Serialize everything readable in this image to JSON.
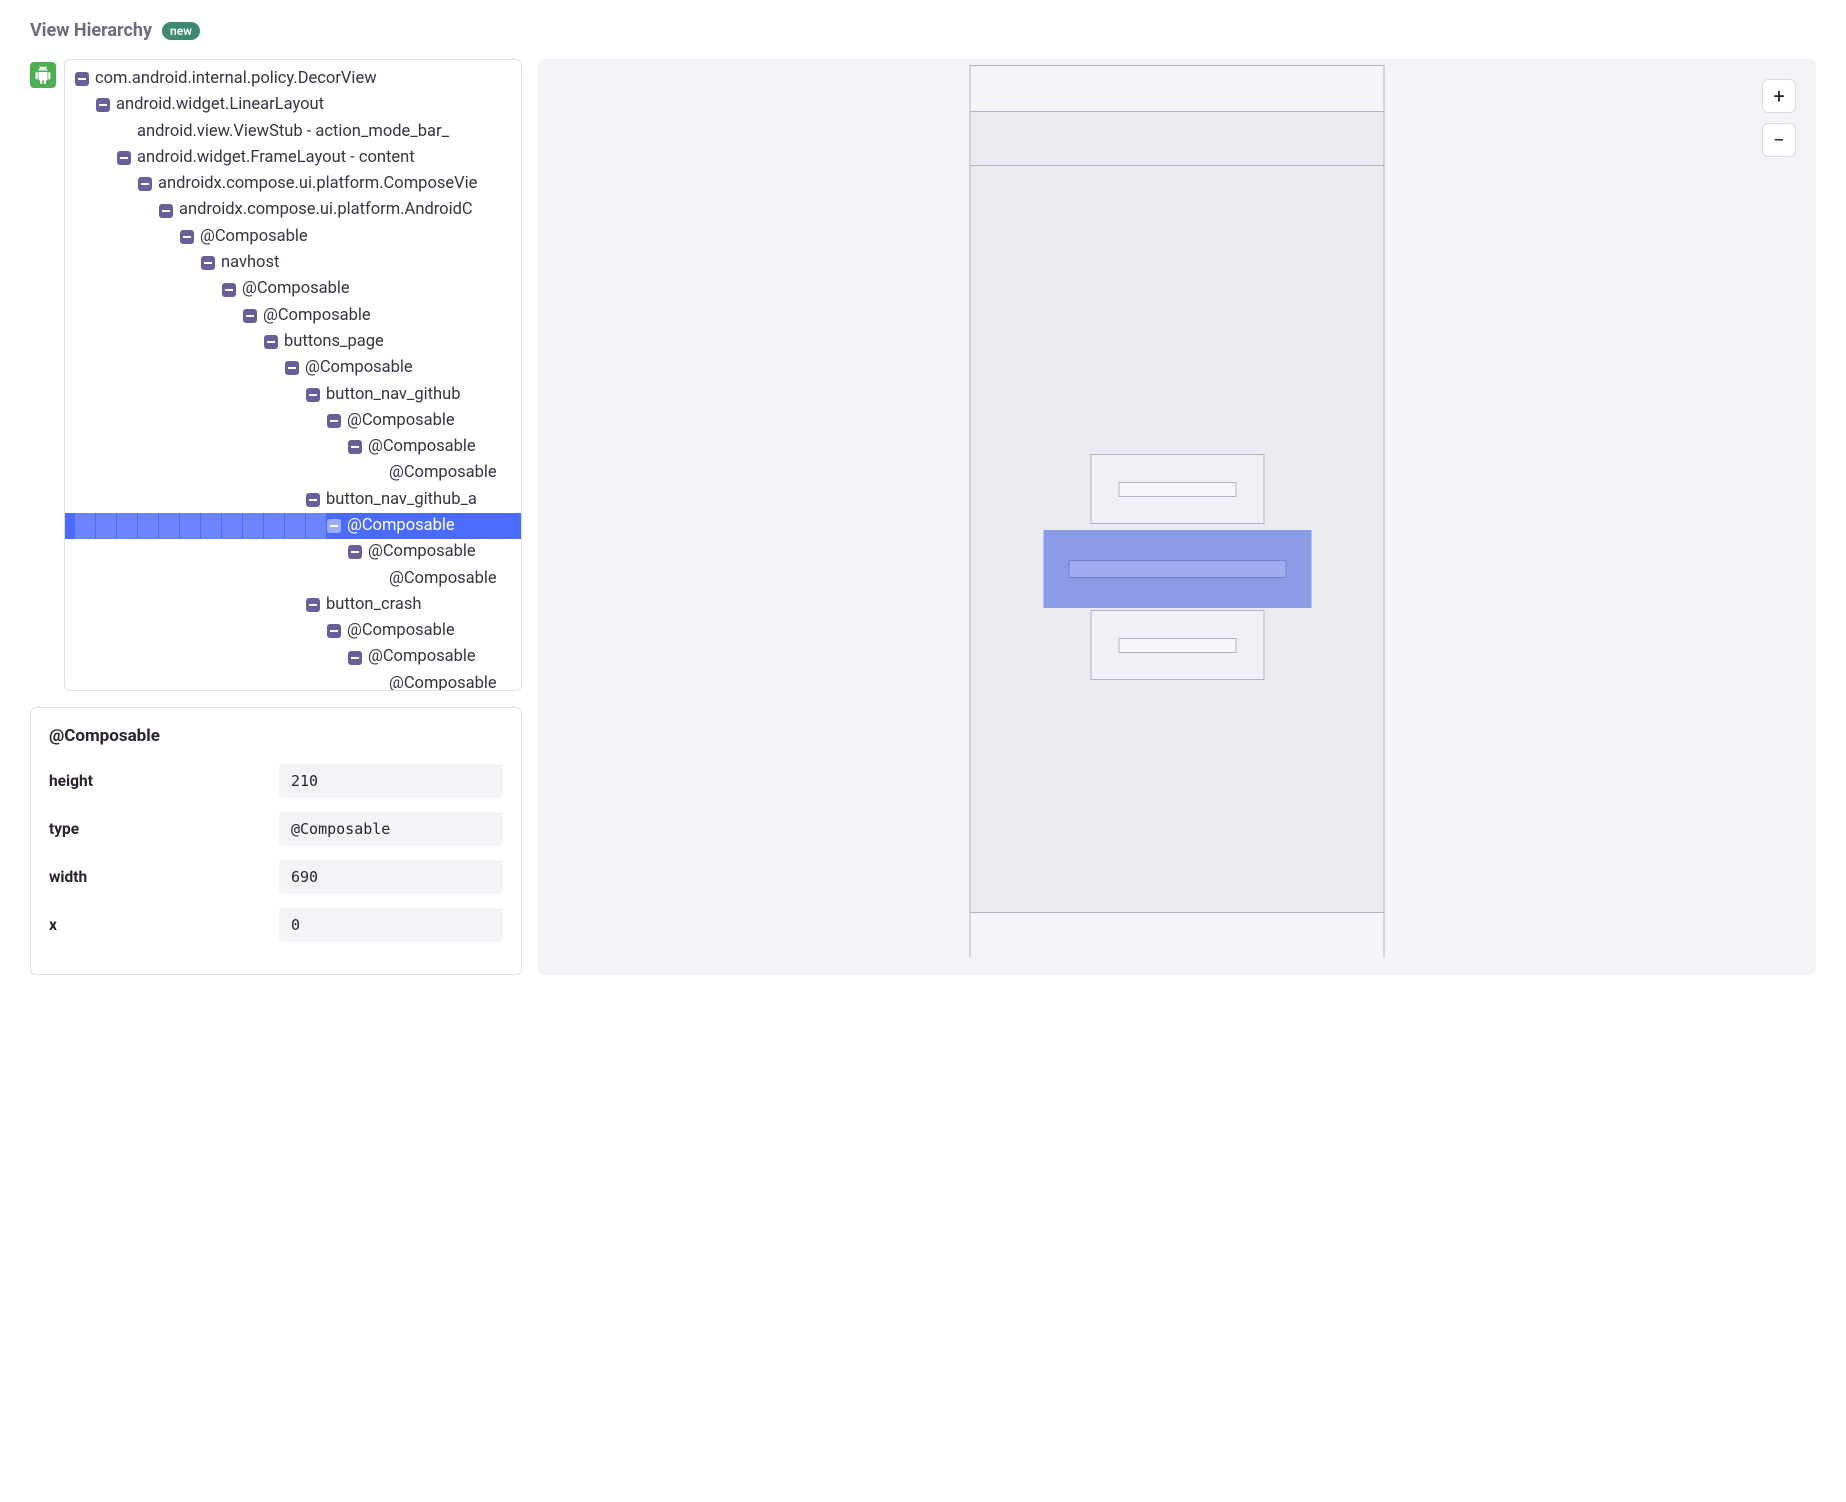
{
  "header": {
    "title": "View Hierarchy",
    "badge": "new"
  },
  "tree": [
    {
      "depth": 0,
      "expand": true,
      "label": "com.android.internal.policy.DecorView",
      "sel": false
    },
    {
      "depth": 1,
      "expand": true,
      "label": "android.widget.LinearLayout",
      "sel": false
    },
    {
      "depth": 2,
      "expand": false,
      "label": "android.view.ViewStub - action_mode_bar_",
      "sel": false
    },
    {
      "depth": 2,
      "expand": true,
      "label": "android.widget.FrameLayout - content",
      "sel": false
    },
    {
      "depth": 3,
      "expand": true,
      "label": "androidx.compose.ui.platform.ComposeVie",
      "sel": false
    },
    {
      "depth": 4,
      "expand": true,
      "label": "androidx.compose.ui.platform.AndroidC",
      "sel": false
    },
    {
      "depth": 5,
      "expand": true,
      "label": "@Composable",
      "sel": false
    },
    {
      "depth": 6,
      "expand": true,
      "label": "navhost",
      "sel": false
    },
    {
      "depth": 7,
      "expand": true,
      "label": "@Composable",
      "sel": false
    },
    {
      "depth": 8,
      "expand": true,
      "label": "@Composable",
      "sel": false
    },
    {
      "depth": 9,
      "expand": true,
      "label": "buttons_page",
      "sel": false
    },
    {
      "depth": 10,
      "expand": true,
      "label": "@Composable",
      "sel": false
    },
    {
      "depth": 11,
      "expand": true,
      "label": "button_nav_github",
      "sel": false
    },
    {
      "depth": 12,
      "expand": true,
      "label": "@Composable",
      "sel": false
    },
    {
      "depth": 13,
      "expand": true,
      "label": "@Composable",
      "sel": false
    },
    {
      "depth": 14,
      "expand": false,
      "label": "@Composable",
      "sel": false
    },
    {
      "depth": 11,
      "expand": true,
      "label": "button_nav_github_a",
      "sel": false
    },
    {
      "depth": 12,
      "expand": true,
      "label": "@Composable",
      "sel": true
    },
    {
      "depth": 13,
      "expand": true,
      "label": "@Composable",
      "sel": false
    },
    {
      "depth": 14,
      "expand": false,
      "label": "@Composable",
      "sel": false
    },
    {
      "depth": 11,
      "expand": true,
      "label": "button_crash",
      "sel": false
    },
    {
      "depth": 12,
      "expand": true,
      "label": "@Composable",
      "sel": false
    },
    {
      "depth": 13,
      "expand": true,
      "label": "@Composable",
      "sel": false
    },
    {
      "depth": 14,
      "expand": false,
      "label": "@Composable",
      "sel": false
    }
  ],
  "details": {
    "title": "@Composable",
    "props": [
      {
        "key": "height",
        "val": "210"
      },
      {
        "key": "type",
        "val": "@Composable"
      },
      {
        "key": "width",
        "val": "690"
      },
      {
        "key": "x",
        "val": "0"
      }
    ]
  },
  "zoom": {
    "in": "+",
    "out": "−"
  }
}
